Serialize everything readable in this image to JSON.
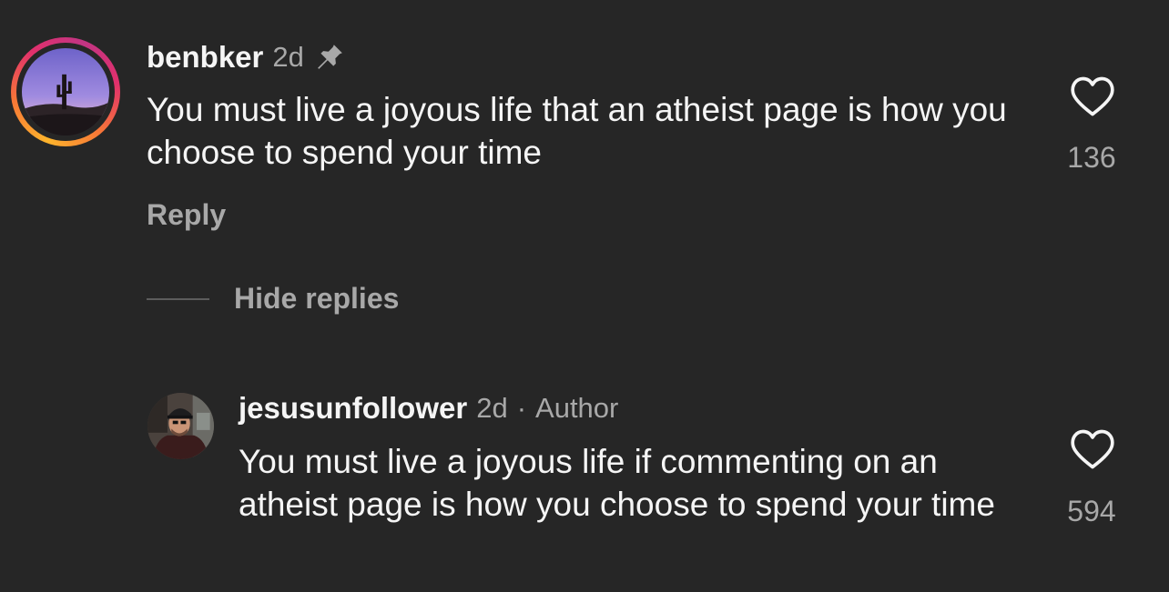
{
  "comment": {
    "username": "benbker",
    "age": "2d",
    "text": "You must live a joyous life that an atheist page is how you choose to spend your time",
    "reply_label": "Reply",
    "like_count": "136",
    "pinned": true
  },
  "hide_replies_label": "Hide replies",
  "reply": {
    "username": "jesusunfollower",
    "age": "2d",
    "separator": "·",
    "author_badge": "Author",
    "text": "You must live a joyous life if commenting on an atheist page is how you choose to spend your time",
    "like_count": "594"
  },
  "icons": {
    "pin": "pin-icon",
    "like": "heart-outline-icon"
  },
  "colors": {
    "background": "#262626",
    "primary_text": "#f5f5f5",
    "secondary_text": "#a8a8a8"
  }
}
